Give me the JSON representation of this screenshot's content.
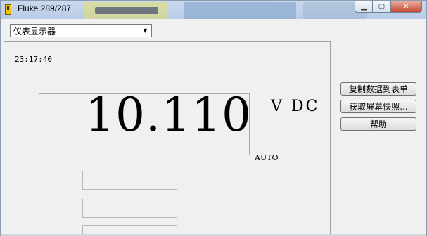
{
  "window": {
    "title": "Fluke 289/287",
    "icon": "fluke-app-icon",
    "caption_buttons": [
      "minimize-icon",
      "maximize-icon",
      "close-icon"
    ]
  },
  "toolbar": {
    "view_select": {
      "value": "仪表显示器"
    }
  },
  "meter": {
    "time": "23:17:40",
    "reading": "10.110",
    "unit": "V DC",
    "range_mode": "AUTO"
  },
  "buttons": {
    "copy": "复制数据到表单",
    "screenshot": "获取屏幕快照...",
    "help": "帮助"
  },
  "colors": {
    "window_bg": "#f0f0f0",
    "titlebar": "#c9d9ee",
    "close_button": "#c74a35"
  }
}
